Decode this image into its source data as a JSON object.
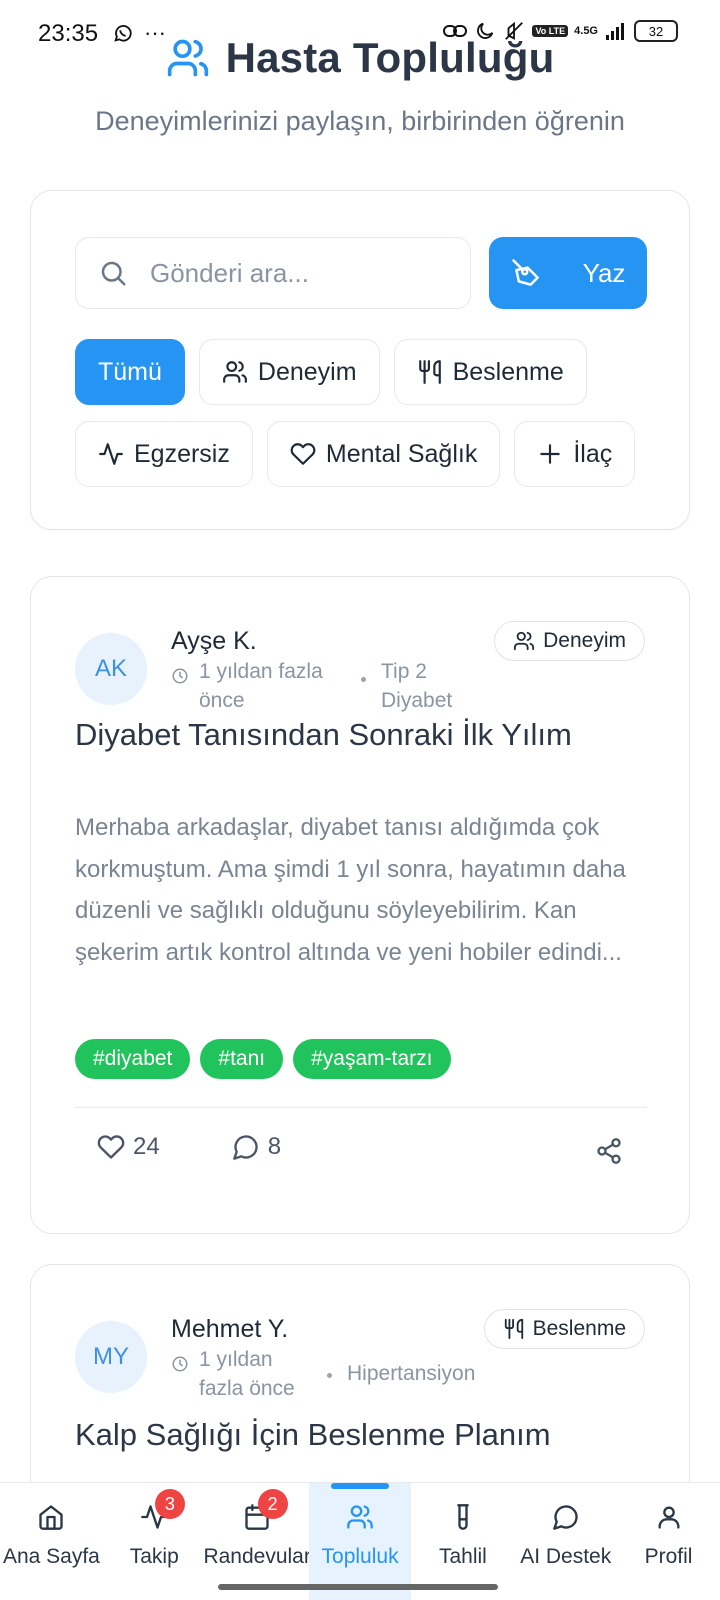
{
  "status_bar": {
    "time": "23:35",
    "network": "4.5G",
    "volte": "Vo LTE",
    "battery": "32"
  },
  "header": {
    "title": "Hasta Topluluğu",
    "subtitle": "Deneyimlerinizi paylaşın, birbirinden öğrenin"
  },
  "search": {
    "placeholder": "Gönderi ara...",
    "write_label": "Yaz"
  },
  "filters": [
    {
      "label": "Tümü",
      "icon": "none",
      "active": true
    },
    {
      "label": "Deneyim",
      "icon": "users-icon"
    },
    {
      "label": "Beslenme",
      "icon": "utensils-icon"
    },
    {
      "label": "Egzersiz",
      "icon": "activity-icon"
    },
    {
      "label": "Mental Sağlık",
      "icon": "heart-icon"
    },
    {
      "label": "İlaç",
      "icon": "plus-icon"
    }
  ],
  "posts": [
    {
      "initials": "AK",
      "author": "Ayşe K.",
      "time": "1 yıldan fazla önce",
      "condition": "Tip 2 Diyabet",
      "category": "Deneyim",
      "title": "Diyabet Tanısından Sonraki İlk Yılım",
      "body": "Merhaba arkadaşlar, diyabet tanısı aldığımda çok korkmuştum. Ama şimdi 1 yıl sonra, hayatımın daha düzenli ve sağlıklı olduğunu söyleyebilirim. Kan şekerim artık kontrol altında ve yeni hobiler edindi...",
      "tags": [
        "#diyabet",
        "#tanı",
        "#yaşam-tarzı"
      ],
      "likes": "24",
      "comments": "8"
    },
    {
      "initials": "MY",
      "author": "Mehmet Y.",
      "time": "1 yıldan fazla önce",
      "condition": "Hipertansiyon",
      "category": "Beslenme",
      "title": "Kalp Sağlığı İçin Beslenme Planım"
    }
  ],
  "nav": [
    {
      "label": "Ana Sayfa",
      "icon": "home-icon"
    },
    {
      "label": "Takip",
      "icon": "activity-icon",
      "badge": "3"
    },
    {
      "label": "Randevular",
      "icon": "calendar-icon",
      "badge": "2"
    },
    {
      "label": "Topluluk",
      "icon": "users-icon",
      "active": true
    },
    {
      "label": "Tahlil",
      "icon": "test-tube-icon"
    },
    {
      "label": "AI Destek",
      "icon": "chat-icon"
    },
    {
      "label": "Profil",
      "icon": "user-icon"
    }
  ],
  "colors": {
    "accent": "#2694f3",
    "tag": "#21c35c",
    "badge": "#ef4444"
  }
}
